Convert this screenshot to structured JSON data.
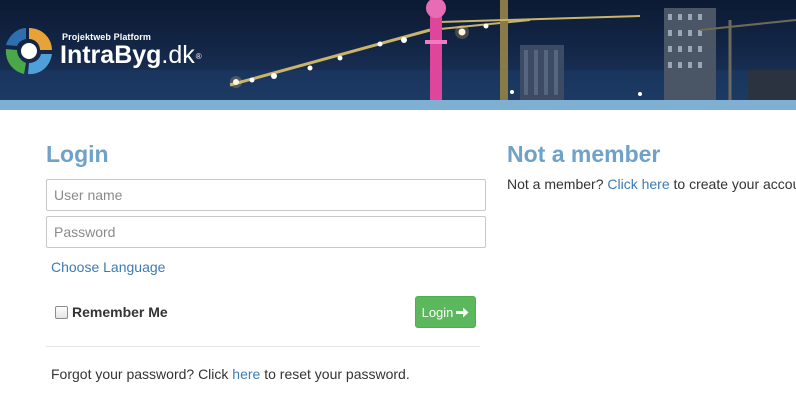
{
  "header": {
    "tagline": "Projektweb Platform",
    "brand_part1": "Intra",
    "brand_part2": "Byg",
    "brand_part3": ".dk",
    "registered_mark": "®"
  },
  "login": {
    "title": "Login",
    "username_placeholder": "User name",
    "password_placeholder": "Password",
    "choose_language": "Choose Language",
    "remember_me": "Remember Me",
    "login_button": "Login",
    "forgot_prefix": "Forgot your password? Click ",
    "forgot_link": "here",
    "forgot_suffix": " to reset your password."
  },
  "member": {
    "title": "Not a member",
    "prefix": "Not a member? ",
    "link": "Click here",
    "suffix": " to create your account fo"
  },
  "colors": {
    "accent": "#6ea2c8",
    "link": "#3c7bb5",
    "button": "#5cb85c",
    "strip": "#7fb0d4"
  },
  "icons": {
    "logo": "intrabyg-logo-icon",
    "button_arrow": "arrow-right-icon"
  }
}
